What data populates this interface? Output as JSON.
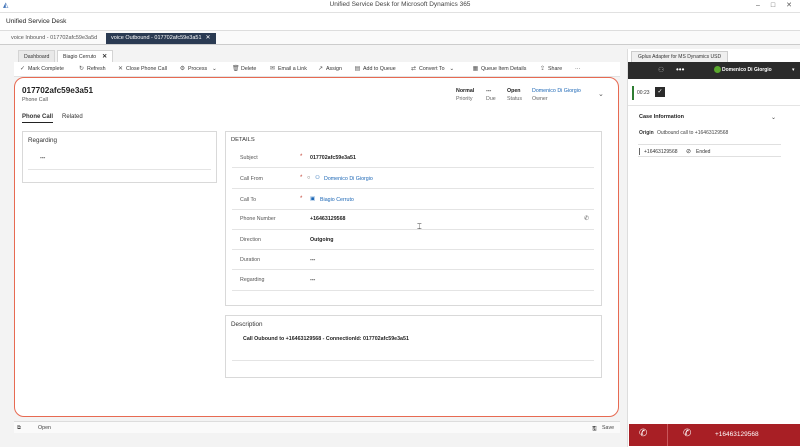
{
  "window": {
    "title": "Unified Service Desk for Microsoft Dynamics 365",
    "app_name": "Unified Service Desk"
  },
  "session_tabs": [
    {
      "label": "voice Inbound - 017702afc59e3a5d"
    },
    {
      "label": "voice Outbound - 017702afc59e3a51"
    }
  ],
  "app_tabs": [
    {
      "label": "Dashboard"
    },
    {
      "label": "Biagio Cerruto"
    }
  ],
  "command_bar": {
    "mark_complete": "Mark Complete",
    "refresh": "Refresh",
    "close_phone_call": "Close Phone Call",
    "process": "Process",
    "delete": "Delete",
    "email_link": "Email a Link",
    "assign": "Assign",
    "add_to_queue": "Add to Queue",
    "convert_to": "Convert To",
    "queue_item_details": "Queue Item Details",
    "share": "Share",
    "more": "···"
  },
  "record": {
    "name": "017702afc59e3a51",
    "entity": "Phone Call",
    "priority_value": "Normal",
    "priority_label": "Priority",
    "due_value": "---",
    "due_label": "Due",
    "status_value": "Open",
    "status_label": "Status",
    "owner_value": "Domenico Di Giorgio",
    "owner_label": "Owner"
  },
  "form_tabs": [
    "Phone Call",
    "Related"
  ],
  "regarding_section": {
    "title": "Regarding",
    "value": "---"
  },
  "details": {
    "title": "DETAILS",
    "subject_label": "Subject",
    "subject_value": "017702afc59e3a51",
    "call_from_label": "Call From",
    "call_from_value": "Domenico Di Giorgio",
    "call_to_label": "Call To",
    "call_to_value": "Biagio Cerruto",
    "phone_label": "Phone Number",
    "phone_value": "+16463129568",
    "direction_label": "Direction",
    "direction_value": "Outgoing",
    "duration_label": "Duration",
    "duration_value": "---",
    "regarding_label": "Regarding",
    "regarding_value": "---"
  },
  "description": {
    "title": "Description",
    "text": "Call Oubound to +16463129568 - ConnectionId: 017702afc59e3a51"
  },
  "bottom_bar": {
    "open_label": "Open",
    "save_label": "Save"
  },
  "adapter": {
    "tab_label": "Gplus Adapter for MS Dynamics USD",
    "agent_name": "Domenico Di Giorgio",
    "dots": "•••",
    "timer": "00:23",
    "case_info_title": "Case Information",
    "origin_label": "Origin",
    "origin_value": "Outbound call to +16463129568",
    "call_number": "+16463129568",
    "call_status": "Ended",
    "callbar_number": "+16463129568"
  },
  "colors": {
    "active_session_tab": "#2a3a52",
    "frame_outline": "#e76a52",
    "link": "#1b66b5",
    "call_bar": "#a81f25",
    "agent_status": "#5aa82e"
  }
}
